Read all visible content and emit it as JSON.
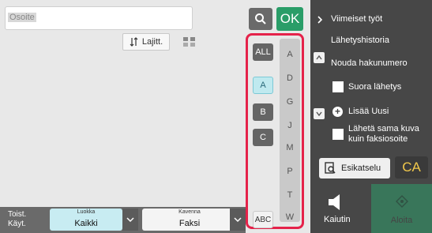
{
  "search": {
    "label": "Osoite"
  },
  "toolbar": {
    "ok_label": "OK",
    "sort_label": "Lajitt."
  },
  "index": {
    "all_label": "ALL",
    "group_buttons": [
      "A",
      "B",
      "C"
    ],
    "abc_label": "ABC",
    "letters": [
      "A",
      "D",
      "G",
      "J",
      "M",
      "P",
      "T",
      "W"
    ]
  },
  "bottom": {
    "repeat_label_line1": "Toist.",
    "repeat_label_line2": "Käyt.",
    "category_label": "Luokka",
    "category_value": "Kaikki",
    "narrow_label": "Kavenna",
    "narrow_value": "Faksi"
  },
  "side": {
    "recent_jobs": "Viimeiset työt",
    "history": "Lähetyshistoria",
    "retrieve": "Nouda hakunumero",
    "direct_send": "Suora lähetys",
    "add_new": "Lisää Uusi",
    "send_same_line1": "Lähetä sama kuva",
    "send_same_line2": "kuin faksiosoite",
    "preview": "Esikatselu",
    "ca": "CA",
    "speaker": "Kaiutin",
    "start": "Aloita"
  },
  "colors": {
    "ok": "#2a9d68",
    "highlight": "#e5224a",
    "ca_text": "#f1c84b",
    "active_tab": "#bfe9ef"
  }
}
